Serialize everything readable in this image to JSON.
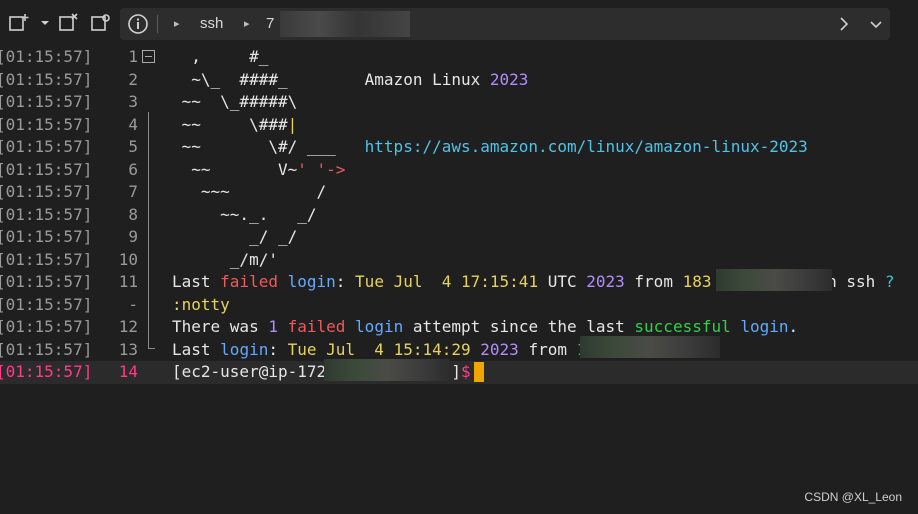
{
  "toolbar": {
    "breadcrumb": [
      {
        "label": "ssh"
      },
      {
        "label": "7"
      }
    ]
  },
  "terminal": {
    "rows": [
      {
        "ts": "[01:15:57]",
        "ln": "1",
        "segments": [
          [
            "white",
            "  ,     #_"
          ]
        ]
      },
      {
        "ts": "[01:15:57]",
        "ln": "2",
        "segments": [
          [
            "white",
            "  ~\\_  ####_        Amazon Linux "
          ],
          [
            "purple",
            "2023"
          ]
        ]
      },
      {
        "ts": "[01:15:57]",
        "ln": "3",
        "segments": [
          [
            "white",
            " ~~  \\_#####\\"
          ]
        ]
      },
      {
        "ts": "[01:15:57]",
        "ln": "4",
        "segments": [
          [
            "white",
            " ~~     \\###"
          ],
          [
            "yellow",
            "|"
          ]
        ]
      },
      {
        "ts": "[01:15:57]",
        "ln": "5",
        "segments": [
          [
            "white",
            " ~~       \\#/ ___   "
          ],
          [
            "cyan",
            "https://aws.amazon.com/linux/amazon-linux-2023"
          ]
        ]
      },
      {
        "ts": "[01:15:57]",
        "ln": "6",
        "segments": [
          [
            "white",
            "  ~~       V~"
          ],
          [
            "red",
            "' '->"
          ]
        ]
      },
      {
        "ts": "[01:15:57]",
        "ln": "7",
        "segments": [
          [
            "white",
            "   ~~~         /"
          ]
        ]
      },
      {
        "ts": "[01:15:57]",
        "ln": "8",
        "segments": [
          [
            "white",
            "     ~~._.   _/"
          ]
        ]
      },
      {
        "ts": "[01:15:57]",
        "ln": "9",
        "segments": [
          [
            "white",
            "        _/ _/"
          ]
        ]
      },
      {
        "ts": "[01:15:57]",
        "ln": "10",
        "segments": [
          [
            "white",
            "      _/m/'"
          ]
        ]
      },
      {
        "ts": "[01:15:57]",
        "ln": "11",
        "segments": [
          [
            "white",
            "Last "
          ],
          [
            "red",
            "failed"
          ],
          [
            "white",
            " "
          ],
          [
            "blue",
            "login"
          ],
          [
            "white",
            ": "
          ],
          [
            "yellow",
            "Tue Jul  4 17:15:41"
          ],
          [
            "white",
            " UTC "
          ],
          [
            "purple",
            "2023"
          ],
          [
            "white",
            " from "
          ],
          [
            "yellow",
            "183"
          ],
          [
            "white",
            "            n ssh "
          ],
          [
            "teal",
            "?"
          ]
        ]
      },
      {
        "ts": "[01:15:57]",
        "ln": "-",
        "segments": [
          [
            "yellow",
            ":notty"
          ]
        ]
      },
      {
        "ts": "[01:15:57]",
        "ln": "12",
        "segments": [
          [
            "white",
            "There was "
          ],
          [
            "purple",
            "1"
          ],
          [
            "white",
            " "
          ],
          [
            "red",
            "failed"
          ],
          [
            "white",
            " "
          ],
          [
            "blue",
            "login"
          ],
          [
            "white",
            " attempt since the last "
          ],
          [
            "green",
            "successful"
          ],
          [
            "white",
            " "
          ],
          [
            "blue",
            "login"
          ],
          [
            "white",
            "."
          ]
        ]
      },
      {
        "ts": "[01:15:57]",
        "ln": "13",
        "segments": [
          [
            "white",
            "Last "
          ],
          [
            "blue",
            "login"
          ],
          [
            "white",
            ": "
          ],
          [
            "yellow",
            "Tue Jul  4 15:14:29"
          ],
          [
            "white",
            " "
          ],
          [
            "purple",
            "2023"
          ],
          [
            "white",
            " from "
          ],
          [
            "green",
            "1"
          ]
        ]
      },
      {
        "ts": "[01:15:57]",
        "ln": "14",
        "active": true,
        "segments": [
          [
            "white",
            "[ec2-user@ip-172"
          ],
          [
            "white",
            "             ]"
          ],
          [
            "magenta",
            "$ "
          ]
        ]
      }
    ]
  },
  "watermark": "CSDN @XL_Leon"
}
